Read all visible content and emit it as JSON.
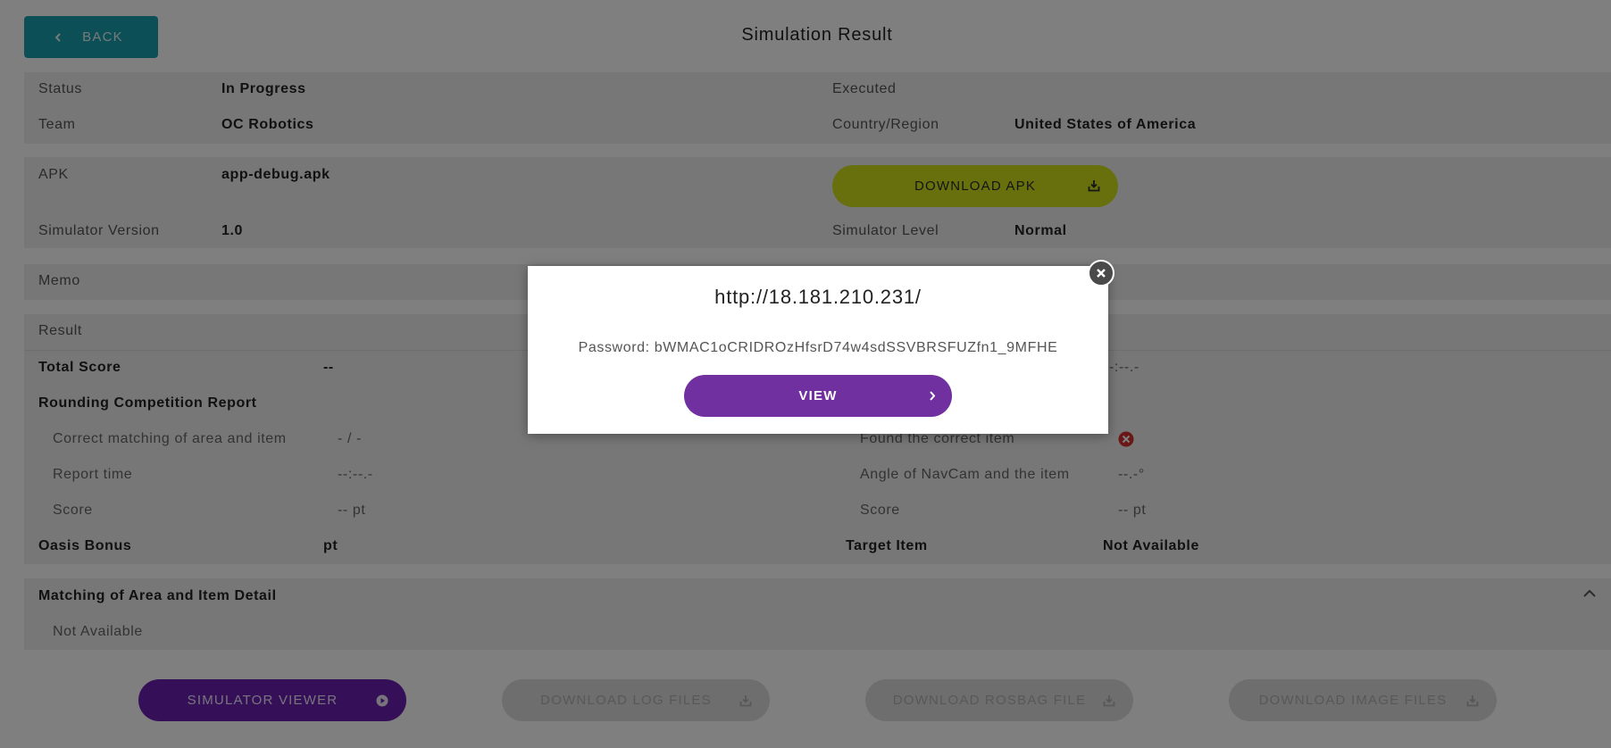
{
  "header": {
    "back_label": "BACK",
    "title": "Simulation Result"
  },
  "info": {
    "status_label": "Status",
    "status_value": "In Progress",
    "executed_label": "Executed",
    "executed_value": "",
    "team_label": "Team",
    "team_value": "OC Robotics",
    "country_label": "Country/Region",
    "country_value": "United States of America"
  },
  "apk": {
    "apk_label": "APK",
    "apk_value": "app-debug.apk",
    "download_label": "DOWNLOAD APK",
    "sim_version_label": "Simulator Version",
    "sim_version_value": "1.0",
    "sim_level_label": "Simulator Level",
    "sim_level_value": "Normal"
  },
  "memo": {
    "label": "Memo"
  },
  "result": {
    "heading": "Result",
    "total_score_label": "Total Score",
    "total_score_value": "--",
    "time_value": "-:--.-",
    "rounding_label": "Rounding Competition Report",
    "left_rows": [
      {
        "label": "Correct matching of area and item",
        "value": "- / -"
      },
      {
        "label": "Report time",
        "value": "--:--.-"
      },
      {
        "label": "Score",
        "value": "-- pt"
      }
    ],
    "right_rows": [
      {
        "label": "Found the correct item",
        "value": ""
      },
      {
        "label": "Angle of NavCam and the item",
        "value": "--.-°"
      },
      {
        "label": "Score",
        "value": "-- pt"
      }
    ],
    "oasis_label": "Oasis Bonus",
    "oasis_value": "pt",
    "target_label": "Target Item",
    "target_value": "Not Available"
  },
  "matching": {
    "heading": "Matching of Area and Item Detail",
    "value": "Not Available"
  },
  "bottom_buttons": {
    "viewer": "SIMULATOR VIEWER",
    "log": "DOWNLOAD LOG FILES",
    "rosbag": "DOWNLOAD ROSBAG FILE",
    "image": "DOWNLOAD IMAGE FILES"
  },
  "modal": {
    "url": "http://18.181.210.231/",
    "password": "Password: bWMAC1oCRIDROzHfsrD74w4sdSSVBRSFUZfn1_9MFHE",
    "view_label": "VIEW"
  },
  "colors": {
    "teal": "#1a9fae",
    "lime": "#cfe01a",
    "purple": "#6a1fb0",
    "error_red": "#d32f2f"
  },
  "icons": [
    "chevron-left-icon",
    "download-icon",
    "close-circle-icon",
    "chevron-up-icon",
    "play-circle-icon",
    "chevron-right-icon",
    "close-icon"
  ]
}
